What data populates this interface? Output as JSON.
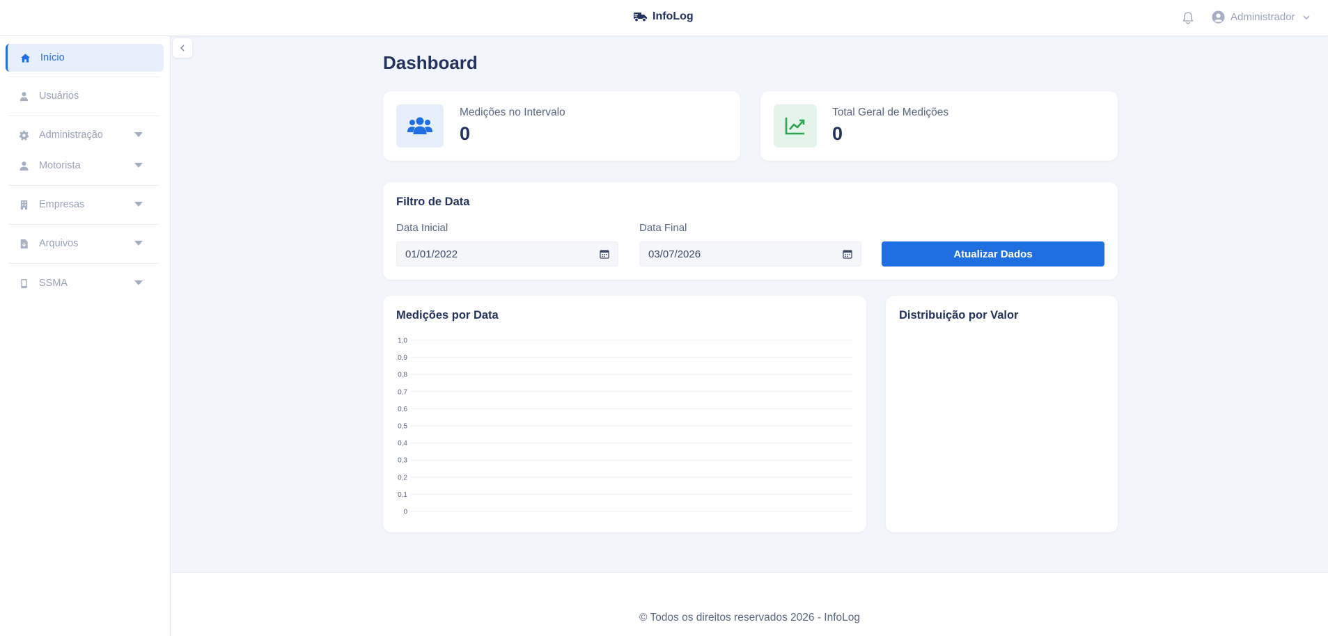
{
  "header": {
    "brand": "InfoLog",
    "user_name": "Administrador"
  },
  "sidebar": {
    "items": [
      {
        "label": "Início",
        "icon": "home-icon",
        "active": true
      },
      {
        "label": "Usuários",
        "icon": "user-tie-icon"
      },
      {
        "label": "Administração",
        "icon": "gear-icon",
        "has_submenu": true
      },
      {
        "label": "Motorista",
        "icon": "user-icon",
        "has_submenu": true
      },
      {
        "label": "Empresas",
        "icon": "building-icon",
        "has_submenu": true
      },
      {
        "label": "Arquivos",
        "icon": "file-icon",
        "has_submenu": true
      },
      {
        "label": "SSMA",
        "icon": "mobile-icon",
        "has_submenu": true
      }
    ]
  },
  "main": {
    "title": "Dashboard",
    "stats": [
      {
        "label": "Medições no Intervalo",
        "value": "0",
        "icon": "users-icon",
        "color": "#1f6fe0"
      },
      {
        "label": "Total Geral de Medições",
        "value": "0",
        "icon": "chart-line-icon",
        "color": "#2ea44f"
      }
    ],
    "filter": {
      "title": "Filtro de Data",
      "start_label": "Data Inicial",
      "start_value": "01/01/2022",
      "end_label": "Data Final",
      "end_value": "03/07/2026",
      "button": "Atualizar Dados"
    },
    "chart_title": "Medições por Data",
    "distribution_title": "Distribuição por Valor"
  },
  "chart_data": {
    "type": "line",
    "title": "Medições por Data",
    "categories": [],
    "series": [],
    "ylim": [
      0,
      1
    ],
    "y_ticks": [
      "0",
      "0,1",
      "0,2",
      "0,3",
      "0,4",
      "0,5",
      "0,6",
      "0,7",
      "0,8",
      "0,9",
      "1,0"
    ],
    "grid": true
  },
  "footer": {
    "text": "© Todos os direitos reservados 2026 - InfoLog"
  },
  "colors": {
    "accent": "#1f6fe0",
    "success": "#2ea44f",
    "title": "#23335e"
  }
}
